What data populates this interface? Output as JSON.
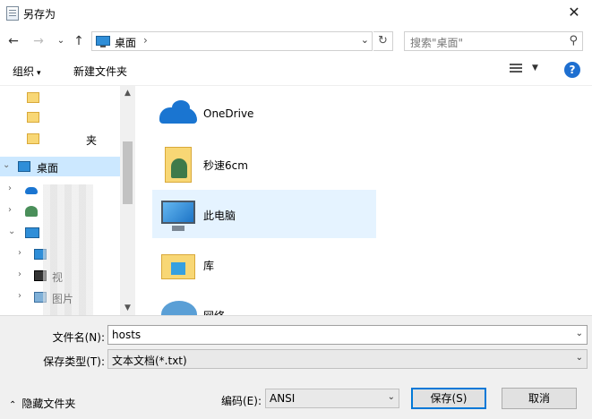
{
  "window": {
    "title": "另存为",
    "close_glyph": "✕"
  },
  "nav": {
    "back_glyph": "←",
    "forward_glyph": "→",
    "recent_glyph": "⌄",
    "up_glyph": "↑",
    "address_path": "桌面",
    "address_sep": "›",
    "address_dd": "⌄",
    "refresh_glyph": "↻",
    "search_placeholder": "搜索\"桌面\"",
    "search_glyph": "⚲"
  },
  "toolbar": {
    "organize_label": "组织",
    "organize_caret": "▾",
    "new_folder_label": "新建文件夹",
    "view_dd": "▼",
    "help_label": "?"
  },
  "tree": {
    "items": [
      {
        "label": "",
        "icon": "folder-icon"
      },
      {
        "label": "",
        "icon": "folder-icon"
      },
      {
        "label": "夹",
        "icon": "folder-icon"
      },
      {
        "label": "桌面",
        "icon": "desktop-icon",
        "chev": "⌄",
        "selected": true
      },
      {
        "label": "",
        "icon": "onedrive-icon",
        "chev": "›"
      },
      {
        "label": "",
        "icon": "user-icon",
        "chev": "›"
      },
      {
        "label": "",
        "icon": "this-pc-icon",
        "chev": "⌄"
      },
      {
        "label": "",
        "icon": "desktop-icon",
        "chev": "›"
      },
      {
        "label": "视",
        "icon": "video-icon",
        "chev": "›"
      },
      {
        "label": "图片",
        "icon": "picture-icon",
        "chev": "›"
      }
    ],
    "scroll_up": "▲",
    "scroll_down": "▼"
  },
  "content": {
    "items": [
      {
        "label": "OneDrive",
        "icon": "onedrive-icon"
      },
      {
        "label": "秒速6cm",
        "icon": "user-folder-icon"
      },
      {
        "label": "此电脑",
        "icon": "this-pc-icon",
        "selected": true
      },
      {
        "label": "库",
        "icon": "library-icon"
      },
      {
        "label": "网络",
        "icon": "network-icon"
      }
    ]
  },
  "form": {
    "filename_label": "文件名(N):",
    "filename_value": "hosts",
    "filetype_label": "保存类型(T):",
    "filetype_value": "文本文档(*.txt)",
    "encoding_label": "编码(E):",
    "encoding_value": "ANSI",
    "dd_glyph": "⌄",
    "hide_folders_caret": "⌃",
    "hide_folders_label": "隐藏文件夹",
    "save_label": "保存(S)",
    "cancel_label": "取消"
  },
  "colors": {
    "selection": "#cce8ff",
    "accent": "#0078d7",
    "help": "#1e6fd0"
  }
}
